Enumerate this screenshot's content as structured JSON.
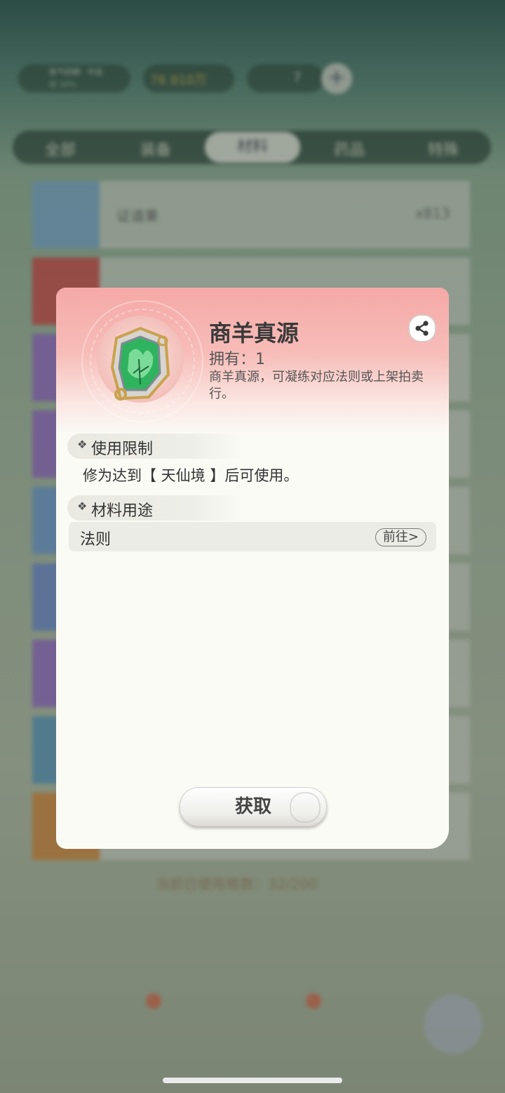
{
  "background": {
    "player": {
      "line1": "炼气初期 · 中品",
      "line2": "修 20%"
    },
    "gold": "76 810万",
    "count": "7",
    "plus_label": "+",
    "tabs": [
      {
        "label": "全部",
        "active": false
      },
      {
        "label": "装备",
        "active": false
      },
      {
        "label": "材料",
        "active": true
      },
      {
        "label": "药品",
        "active": false
      },
      {
        "label": "特殊",
        "active": false
      }
    ],
    "rows": [
      {
        "name": "证道果",
        "count": "x813",
        "thumb_color": "#7fb0d8"
      },
      {
        "name": "",
        "count": "",
        "thumb_color": "#d84a4a"
      },
      {
        "name": "",
        "count": "",
        "thumb_color": "#9a6ed1"
      },
      {
        "name": "",
        "count": "",
        "thumb_color": "#9a6ed1"
      },
      {
        "name": "",
        "count": "",
        "thumb_color": "#6fa0dc"
      },
      {
        "name": "",
        "count": "",
        "thumb_color": "#6f8fd8"
      },
      {
        "name": "",
        "count": "",
        "thumb_color": "#9a6ed1"
      },
      {
        "name": "",
        "count": "",
        "thumb_color": "#5a9fc8"
      },
      {
        "name": "",
        "count": "",
        "thumb_color": "#e08e3c"
      }
    ],
    "capacity": "当前已使用格数：32/200",
    "nav": [
      "",
      "",
      "",
      "",
      ""
    ]
  },
  "modal": {
    "title": "商羊真源",
    "owned": "拥有：1",
    "description": "商羊真源，可凝练对应法则或上架拍卖行。",
    "share_icon": "share-icon",
    "sections": {
      "limit": {
        "title": "使用限制",
        "text": "修为达到【 天仙境 】后可使用。"
      },
      "usage": {
        "title": "材料用途",
        "item_name": "法则",
        "goto_label": "前往>"
      }
    },
    "obtain_label": "获取"
  },
  "colors": {
    "modal_header_top": "#f5a9a6",
    "modal_body": "#fbfbf6",
    "item_green": "#2fb35e",
    "frame_gold": "#c9a24f"
  }
}
